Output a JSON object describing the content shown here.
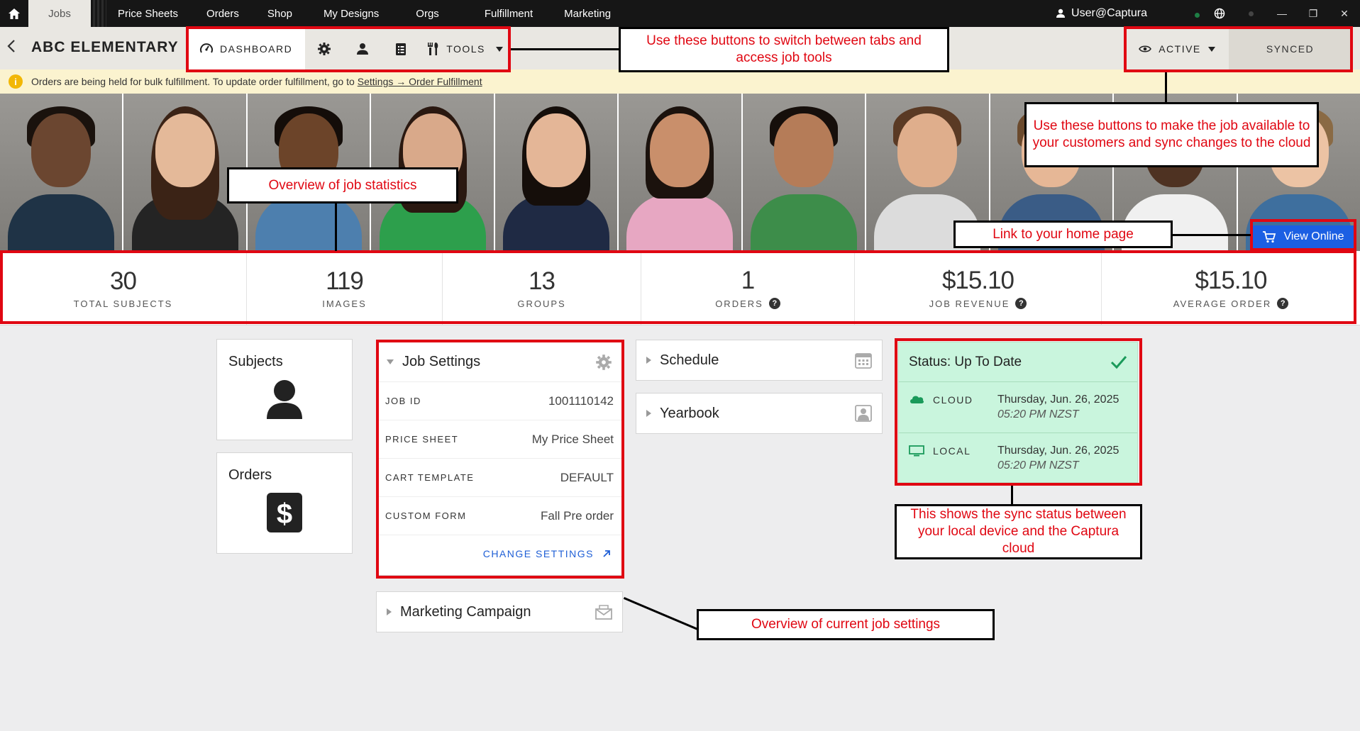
{
  "nav": {
    "tabs": [
      "Jobs",
      "Price Sheets",
      "Orders",
      "Shop",
      "My Designs",
      "Orgs",
      "Fulfillment",
      "Marketing"
    ],
    "user": "User@Captura",
    "window_controls": [
      "globe-icon",
      "dot-icon",
      "minimize-icon",
      "restore-icon",
      "close-icon"
    ]
  },
  "job": {
    "title": "ABC ELEMENTARY",
    "dashboard_label": "DASHBOARD",
    "tools_label": "TOOLS",
    "active_label": "ACTIVE",
    "synced_label": "SYNCED"
  },
  "notice": {
    "text": "Orders are being held for bulk fulfillment. To update order fulfillment, go to",
    "link": "Settings → Order Fulfillment"
  },
  "stats": [
    {
      "value": "30",
      "label": "TOTAL SUBJECTS",
      "help": false
    },
    {
      "value": "119",
      "label": "IMAGES",
      "help": false
    },
    {
      "value": "13",
      "label": "GROUPS",
      "help": false
    },
    {
      "value": "1",
      "label": "ORDERS",
      "help": true
    },
    {
      "value": "$15.10",
      "label": "JOB REVENUE",
      "help": true
    },
    {
      "value": "$15.10",
      "label": "AVERAGE ORDER",
      "help": true
    }
  ],
  "tiles": {
    "subjects": "Subjects",
    "orders": "Orders"
  },
  "job_settings": {
    "title": "Job Settings",
    "rows": [
      {
        "key": "JOB ID",
        "value": "1001110142"
      },
      {
        "key": "PRICE SHEET",
        "value": "My Price Sheet"
      },
      {
        "key": "CART TEMPLATE",
        "value": "DEFAULT"
      },
      {
        "key": "CUSTOM FORM",
        "value": "Fall Pre order"
      }
    ],
    "change_label": "CHANGE SETTINGS"
  },
  "marketing": "Marketing Campaign",
  "schedule": "Schedule",
  "yearbook": "Yearbook",
  "status": {
    "title": "Status: Up To Date",
    "cloud_label": "CLOUD",
    "cloud_date": "Thursday, Jun. 26, 2025",
    "cloud_time": "05:20 PM NZST",
    "local_label": "LOCAL",
    "local_date": "Thursday, Jun. 26, 2025",
    "local_time": "05:20 PM NZST"
  },
  "view_online": "View Online",
  "annotations": {
    "tabs": "Use these buttons to switch between tabs and access job tools",
    "active": "Use these buttons to make the job available to your customers and sync changes to the cloud",
    "stats": "Overview of job statistics",
    "home": "Link to your home page",
    "sync": "This shows the sync status between your local device and the Captura cloud",
    "settings": "Overview of current job settings"
  },
  "colors": {
    "accent_blue": "#1b5fe3",
    "annotation_red": "#e00712",
    "status_green": "#c9f5dd",
    "check_green": "#1a9a5a"
  }
}
